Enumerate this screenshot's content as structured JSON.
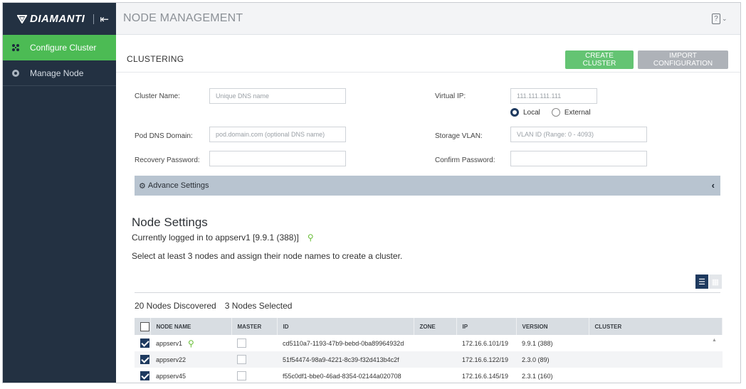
{
  "sidebar": {
    "brand": "DIAMANTI",
    "items": [
      {
        "label": "Configure Cluster",
        "active": true
      },
      {
        "label": "Manage Node",
        "active": false
      }
    ]
  },
  "header": {
    "title": "NODE MANAGEMENT"
  },
  "clustering": {
    "title": "CLUSTERING",
    "create_button": "CREATE CLUSTER",
    "import_button": "IMPORT CONFIGURATION",
    "fields": {
      "cluster_name_label": "Cluster Name:",
      "cluster_name_placeholder": "Unique DNS name",
      "virtual_ip_label": "Virtual IP:",
      "virtual_ip_placeholder": "111.111.111.111",
      "pod_dns_label": "Pod DNS Domain:",
      "pod_dns_placeholder": "pod.domain.com (optional DNS name)",
      "storage_vlan_label": "Storage VLAN:",
      "storage_vlan_placeholder": "VLAN ID (Range: 0 - 4093)",
      "recovery_password_label": "Recovery Password:",
      "confirm_password_label": "Confirm Password:"
    },
    "ip_mode": {
      "local": "Local",
      "external": "External",
      "selected": "Local"
    },
    "advance_settings": "Advance Settings"
  },
  "node_settings": {
    "title": "Node Settings",
    "logged_in": "Currently logged in to appserv1 [9.9.1 (388)]",
    "instruction": "Select at least 3 nodes and assign their node names to create a cluster.",
    "discovered": "20 Nodes Discovered",
    "selected": "3 Nodes Selected",
    "columns": [
      "NODE NAME",
      "MASTER",
      "ID",
      "ZONE",
      "IP",
      "VERSION",
      "CLUSTER"
    ],
    "rows": [
      {
        "name": "appserv1",
        "current": true,
        "checked": true,
        "master": false,
        "id": "cd5110a7-1193-47b9-bebd-0ba89964932d",
        "zone": "",
        "ip": "172.16.6.101/19",
        "version": "9.9.1 (388)",
        "cluster": ""
      },
      {
        "name": "appserv22",
        "current": false,
        "checked": true,
        "master": false,
        "id": "51f54474-98a9-4221-8c39-f32d413b4c2f",
        "zone": "",
        "ip": "172.16.6.122/19",
        "version": "2.3.0 (89)",
        "cluster": ""
      },
      {
        "name": "appserv45",
        "current": false,
        "checked": true,
        "master": false,
        "id": "f55c0df1-bbe0-46ad-8354-02144a020708",
        "zone": "",
        "ip": "172.16.6.145/19",
        "version": "2.3.1 (160)",
        "cluster": ""
      }
    ]
  },
  "colors": {
    "sidebar_bg": "#233142",
    "active_green": "#4cbb54",
    "create_button": "#64c473",
    "import_button": "#aeb2b8",
    "accent_navy": "#1e3a5f"
  }
}
